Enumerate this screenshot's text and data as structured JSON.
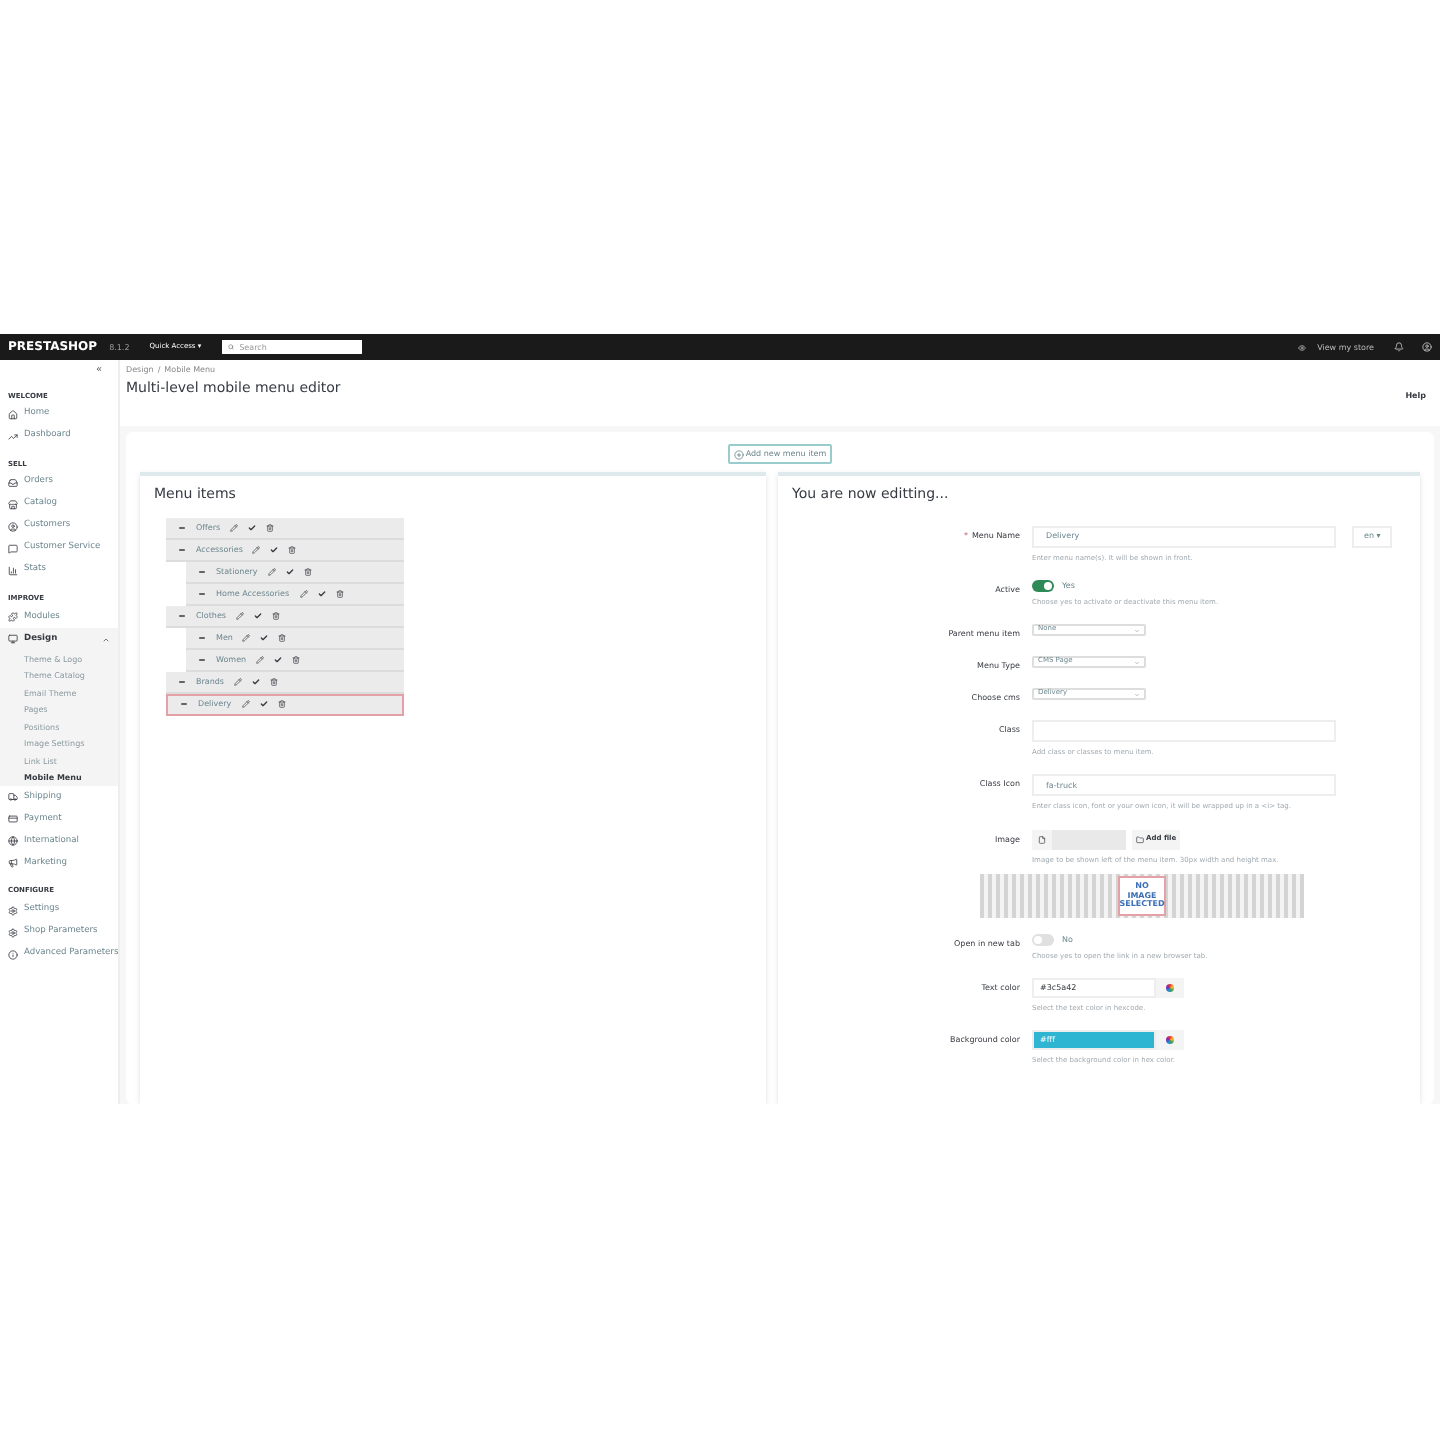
{
  "topbar": {
    "logo": "PRESTASHOP",
    "version": "8.1.2",
    "quick_access": "Quick Access ▾",
    "search": {
      "placeholder": "Search"
    },
    "view_store": "View my store"
  },
  "sidebar": {
    "collapse": "«",
    "sections": [
      {
        "title": "WELCOME",
        "items": [
          {
            "label": "Home",
            "selected": false
          },
          {
            "label": "Dashboard",
            "selected": false
          }
        ]
      },
      {
        "title": "SELL",
        "items": [
          {
            "label": "Orders",
            "selected": false
          },
          {
            "label": "Catalog",
            "selected": false
          },
          {
            "label": "Customers",
            "selected": false
          },
          {
            "label": "Customer Service",
            "selected": false
          },
          {
            "label": "Stats",
            "selected": false
          }
        ]
      },
      {
        "title": "IMPROVE",
        "items": [
          {
            "label": "Modules",
            "selected": false
          },
          {
            "label": "Design",
            "selected": true,
            "expanded": true,
            "children": [
              {
                "label": "Theme & Logo",
                "selected": false
              },
              {
                "label": "Theme Catalog",
                "selected": false
              },
              {
                "label": "Email Theme",
                "selected": false
              },
              {
                "label": "Pages",
                "selected": false
              },
              {
                "label": "Positions",
                "selected": false
              },
              {
                "label": "Image Settings",
                "selected": false
              },
              {
                "label": "Link List",
                "selected": false
              },
              {
                "label": "Mobile Menu",
                "selected": true
              }
            ]
          },
          {
            "label": "Shipping",
            "selected": false
          },
          {
            "label": "Payment",
            "selected": false
          },
          {
            "label": "International",
            "selected": false
          },
          {
            "label": "Marketing",
            "selected": false
          }
        ]
      },
      {
        "title": "CONFIGURE",
        "items": [
          {
            "label": "Settings",
            "selected": false
          },
          {
            "label": "Shop Parameters",
            "selected": false
          },
          {
            "label": "Advanced Parameters",
            "selected": false
          }
        ]
      }
    ]
  },
  "breadcrumb": {
    "items": [
      "Design",
      "Mobile Menu"
    ],
    "separator": "/"
  },
  "page_title": "Multi-level mobile menu editor",
  "help": "Help",
  "add_button": "Add new menu item",
  "menu_panel": {
    "title": "Menu items",
    "items": [
      {
        "label": "Offers",
        "selected": false
      },
      {
        "label": "Accessories",
        "selected": false,
        "children": [
          {
            "label": "Stationery",
            "selected": false
          },
          {
            "label": "Home Accessories",
            "selected": false
          }
        ]
      },
      {
        "label": "Clothes",
        "selected": false,
        "children": [
          {
            "label": "Men",
            "selected": false
          },
          {
            "label": "Women",
            "selected": false
          }
        ]
      },
      {
        "label": "Brands",
        "selected": false
      },
      {
        "label": "Delivery",
        "selected": true
      }
    ]
  },
  "edit_panel": {
    "title": "You are now editting...",
    "fields": [
      {
        "kind": "text",
        "label": "Menu Name",
        "marker": "*",
        "value": "Delivery",
        "lang": "en ▾",
        "hint": "Enter menu name(s). It will be shown in front."
      },
      {
        "kind": "switch",
        "label": "Active",
        "on": true,
        "value": "Yes",
        "hint": "Choose yes to activate or deactivate this menu item."
      },
      {
        "kind": "select",
        "label": "Parent menu item",
        "value": "None"
      },
      {
        "kind": "select",
        "label": "Menu Type",
        "value": "CMS Page"
      },
      {
        "kind": "select",
        "label": "Choose cms",
        "value": "Delivery"
      },
      {
        "kind": "text",
        "label": "Class",
        "hint": "Add class or classes to menu item."
      },
      {
        "kind": "text",
        "label": "Class Icon",
        "value": "fa-truck",
        "hint": "Enter class icon, font or your own icon, it will be wrapped up in a <i> tag."
      },
      {
        "kind": "image",
        "label": "Image",
        "button": "Add file",
        "hint": "Image to be shown left of the menu item. 30px width and height max.",
        "preview": "NO IMAGE SELECTED"
      },
      {
        "kind": "switch",
        "label": "Open in new tab",
        "on": false,
        "value": "No",
        "hint": "Choose yes to open the link in a new browser tab."
      },
      {
        "kind": "color",
        "label": "Text color",
        "value": "#3c5a42",
        "hint": "Select the text color in hexcode."
      },
      {
        "kind": "color_filled",
        "label": "Background color",
        "value": "#fff",
        "hint": "Select the background color in hex color."
      }
    ]
  }
}
